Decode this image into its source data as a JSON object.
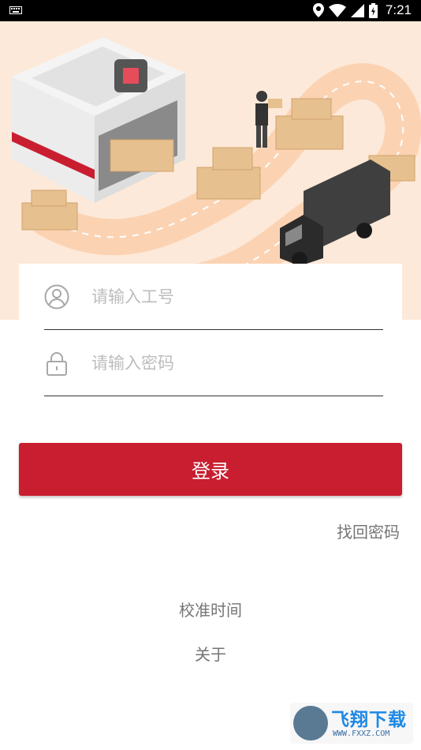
{
  "status_bar": {
    "time": "7:21",
    "icons": [
      "keyboard-icon",
      "location-icon",
      "wifi-icon",
      "signal-icon",
      "battery-charging-icon"
    ]
  },
  "hero": {
    "illustration": "warehouse-delivery-illustration",
    "background_color": "#fde9d9"
  },
  "login_form": {
    "username_placeholder": "请输入工号",
    "password_placeholder": "请输入密码",
    "username_icon": "user-icon",
    "password_icon": "lock-icon"
  },
  "actions": {
    "login_label": "登录",
    "forgot_password_label": "找回密码",
    "calibrate_time_label": "校准时间",
    "about_label": "关于"
  },
  "watermark": {
    "brand": "飞翔下载",
    "domain": "WWW.FXXZ.COM"
  },
  "colors": {
    "accent": "#c81e30",
    "link": "#757575",
    "placeholder": "#bdbdbd"
  }
}
